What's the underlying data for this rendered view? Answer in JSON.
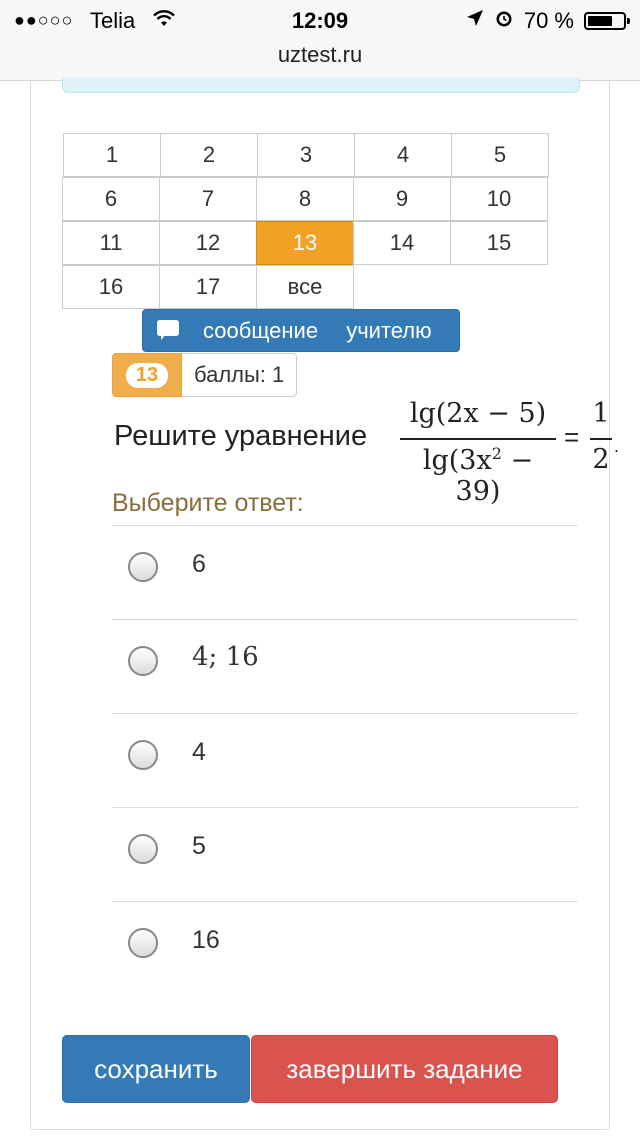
{
  "status_bar": {
    "signal": "●●○○○",
    "carrier": "Telia",
    "time": "12:09",
    "battery": "70 %",
    "battery_level": 0.7,
    "icons": [
      "signal-icon",
      "wifi-icon",
      "location-icon",
      "alarm-icon",
      "battery-icon"
    ]
  },
  "browser": {
    "url": "uztest.ru"
  },
  "question_nav": {
    "rows": [
      [
        "1",
        "2",
        "3",
        "4",
        "5"
      ],
      [
        "6",
        "7",
        "8",
        "9",
        "10"
      ],
      [
        "11",
        "12",
        "13",
        "14",
        "15"
      ],
      [
        "16",
        "17",
        "все"
      ]
    ],
    "active": "13"
  },
  "message_button": {
    "label": "сообщение учителю",
    "icon": "comment-icon"
  },
  "points_badge": {
    "number": "13",
    "label": "баллы: 1"
  },
  "question": {
    "text": "Решите уравнение",
    "numerator": "lg(2x − 5)",
    "denominator_pre": "lg(3x",
    "denominator_exp": "2",
    "denominator_post": " − 39)",
    "equals": "=",
    "rhs_numerator": "1",
    "rhs_denominator": "2",
    "end": "."
  },
  "answers": {
    "prompt": "Выберите ответ:",
    "options": [
      "6",
      "4; 16",
      "4",
      "5",
      "16"
    ]
  },
  "actions": {
    "save_label": "сохранить",
    "finish_label": "завершить задание"
  },
  "colors": {
    "primary": "#337ab7",
    "danger": "#d9534f",
    "warning": "#f0ad4e",
    "active_cell": "#f0a126",
    "prompt": "#8a6d3b"
  }
}
